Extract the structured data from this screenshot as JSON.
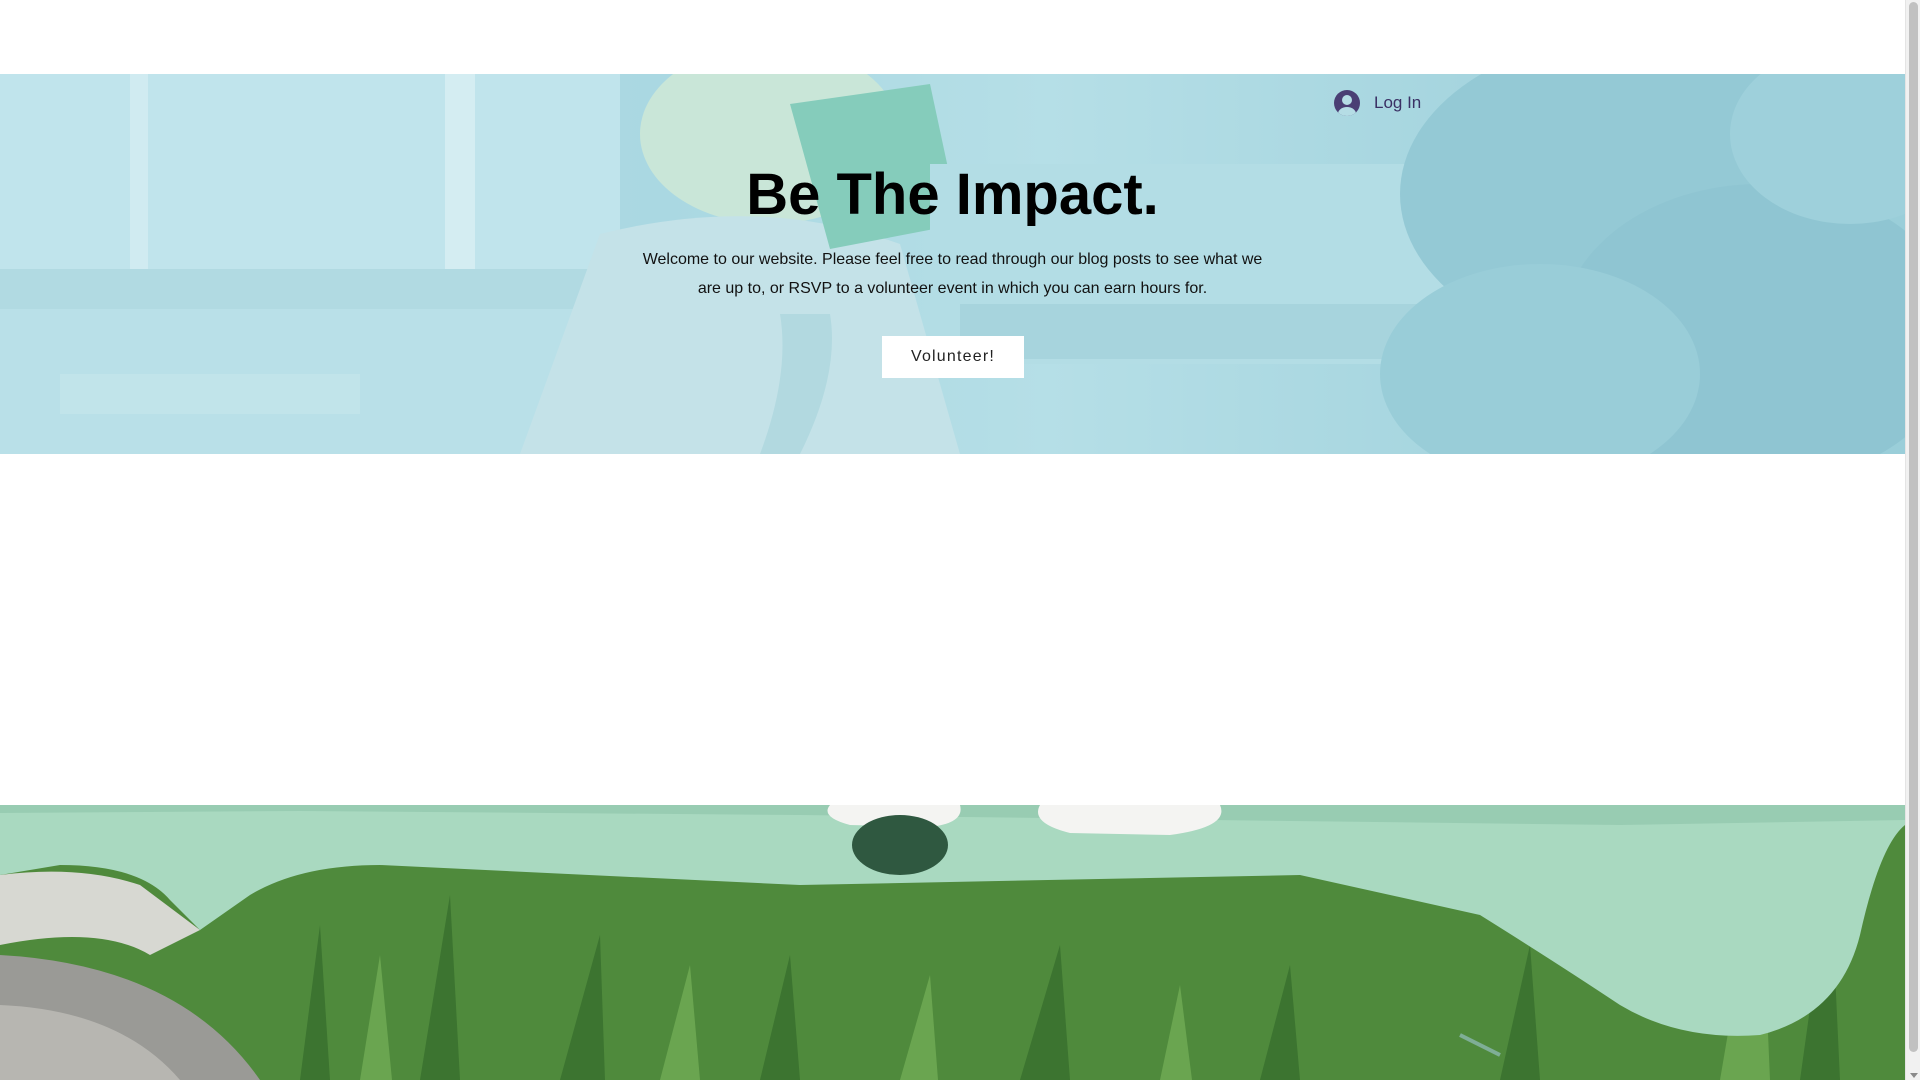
{
  "header": {
    "login_label": "Log In",
    "login_icon": "user-avatar-icon"
  },
  "hero": {
    "title": "Be The Impact.",
    "text": "Welcome to our website. Please feel free to read through our blog posts to see what we are up to, or RSVP to a volunteer event in which you can earn hours for.",
    "button_label": "Volunteer!",
    "overlay_color": "#b0dee8"
  },
  "colors": {
    "accent": "#3a3064",
    "hero_tint": "#a8d6df",
    "bench_green": "#a9d9c0",
    "grass_green": "#4f8a3c"
  }
}
